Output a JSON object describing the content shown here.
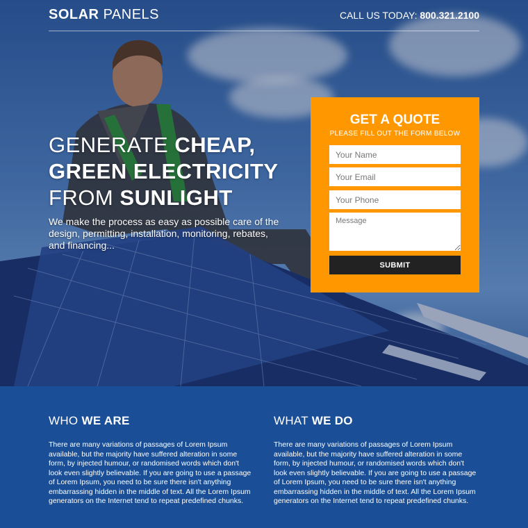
{
  "header": {
    "logo_bold": "SOLAR",
    "logo_light": "PANELS",
    "call_label": "CALL US TODAY:",
    "phone": "800.321.2100"
  },
  "hero": {
    "line1_light": "GENERATE",
    "line1_bold": "CHEAP,",
    "line2_bold": "GREEN ELECTRICITY",
    "line3_light": "FROM",
    "line3_bold": "SUNLIGHT",
    "subtext": "We make the process as easy as possible care of the design, permitting, installation, monitoring, rebates, and financing..."
  },
  "quote_form": {
    "title": "GET A QUOTE",
    "subtitle": "PLEASE FILL OUT THE FORM BELOW",
    "name_placeholder": "Your Name",
    "email_placeholder": "Your Email",
    "phone_placeholder": "Your Phone",
    "message_placeholder": "Message",
    "submit_label": "SUBMIT",
    "background_color": "#ff9800"
  },
  "who_we_are": {
    "title_light": "WHO",
    "title_bold": "WE ARE",
    "body": "There are many variations of passages of Lorem Ipsum available, but the majority have suffered alteration in some form, by injected humour, or randomised words which don't look even slightly believable. If you are going to use a passage of Lorem Ipsum, you need to be sure there isn't anything embarrassing hidden in the middle of text. All the Lorem Ipsum generators on the Internet tend to repeat predefined chunks."
  },
  "what_we_do": {
    "title_light": "WHAT",
    "title_bold": "WE DO",
    "body": "There are many variations of passages of Lorem Ipsum available, but the majority have suffered alteration in some form, by injected humour, or randomised words which don't look even slightly believable. If you are going to use a passage of Lorem Ipsum, you need to be sure there isn't anything embarrassing hidden in the middle of text. All the Lorem Ipsum generators on the Internet tend to repeat predefined chunks."
  },
  "colors": {
    "accent": "#ff9800",
    "section_bg": "#1a4f97",
    "button_bg": "#222222"
  }
}
